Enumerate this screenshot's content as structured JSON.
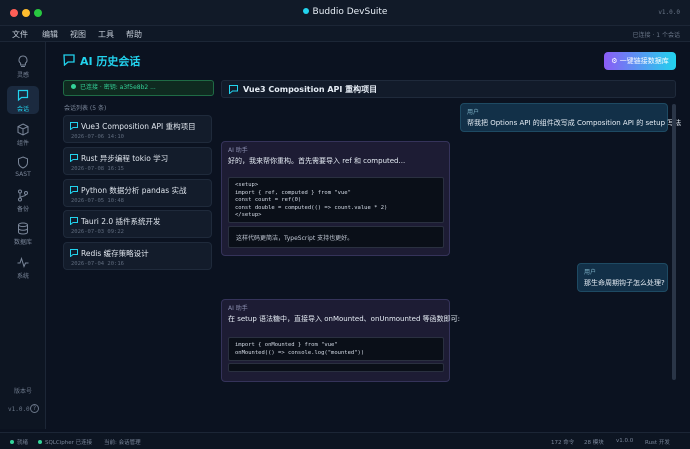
{
  "window": {
    "title": "Buddio DevSuite",
    "version": "v1.0.0"
  },
  "menu": {
    "items": [
      "文件",
      "编辑",
      "视图",
      "工具",
      "帮助"
    ],
    "status": "已连接 · 1 个会话"
  },
  "sidebar": {
    "items": [
      {
        "label": "灵感",
        "icon": "lightbulb-icon"
      },
      {
        "label": "会话",
        "icon": "chat-icon"
      },
      {
        "label": "组件",
        "icon": "cube-icon"
      },
      {
        "label": "SAST",
        "icon": "shield-icon"
      },
      {
        "label": "备份",
        "icon": "branch-icon"
      },
      {
        "label": "数据库",
        "icon": "database-icon"
      },
      {
        "label": "系统",
        "icon": "pulse-icon"
      }
    ],
    "version_label": "版本号",
    "version": "v1.0.0",
    "help": "?"
  },
  "page": {
    "title": "AI 历史会话",
    "connect_button": "⚙ 一键链接数据库"
  },
  "connection": {
    "text": "已连接 · 密钥: a3f5e8b2 ..."
  },
  "sessions": {
    "header": "会话列表 (5 条)",
    "items": [
      {
        "title": "Vue3 Composition API 重构项目",
        "date": "2026-07-06 14:10"
      },
      {
        "title": "Rust 异步编程 tokio 学习",
        "date": "2026-07-08 16:15"
      },
      {
        "title": "Python 数据分析 pandas 实战",
        "date": "2026-07-05 10:48"
      },
      {
        "title": "Tauri 2.0 插件系统开发",
        "date": "2026-07-03 09:22"
      },
      {
        "title": "Redis 缓存策略设计",
        "date": "2026-07-04 20:16"
      }
    ]
  },
  "chat": {
    "title": "Vue3 Composition API 重构项目",
    "messages": [
      {
        "role": "用户",
        "text": "帮我把 Options API 的组件改写成 Composition API 的 setup 写法"
      },
      {
        "role": "AI 助手",
        "text": "好的，我来帮你重构。首先需要导入 ref 和 computed...",
        "code": "<setup>\nimport { ref, computed } from \"vue\"\nconst count = ref(0)\nconst double = computed(() => count.value * 2)\n</setup>",
        "followup": "这样代码更简洁，TypeScript 支持也更好。"
      },
      {
        "role": "用户",
        "text": "那生命周期钩子怎么处理?"
      },
      {
        "role": "AI 助手",
        "text": "在 setup 语法糖中，直接导入 onMounted、onUnmounted 等函数即可:",
        "code": "import { onMounted } from \"vue\"\nonMounted(() => console.log(\"mounted\"))"
      }
    ]
  },
  "statusbar": {
    "left": [
      "就绪",
      "SQLCipher 已连接",
      "当前: 会话管理"
    ],
    "right": [
      "172 命令",
      "28 模块",
      "v1.0.0",
      "Rust 开发"
    ]
  },
  "colors": {
    "accent": "#22d3ee",
    "success": "#34d399",
    "ai_bubble": "#1d1c34",
    "user_bubble": "#123048"
  }
}
